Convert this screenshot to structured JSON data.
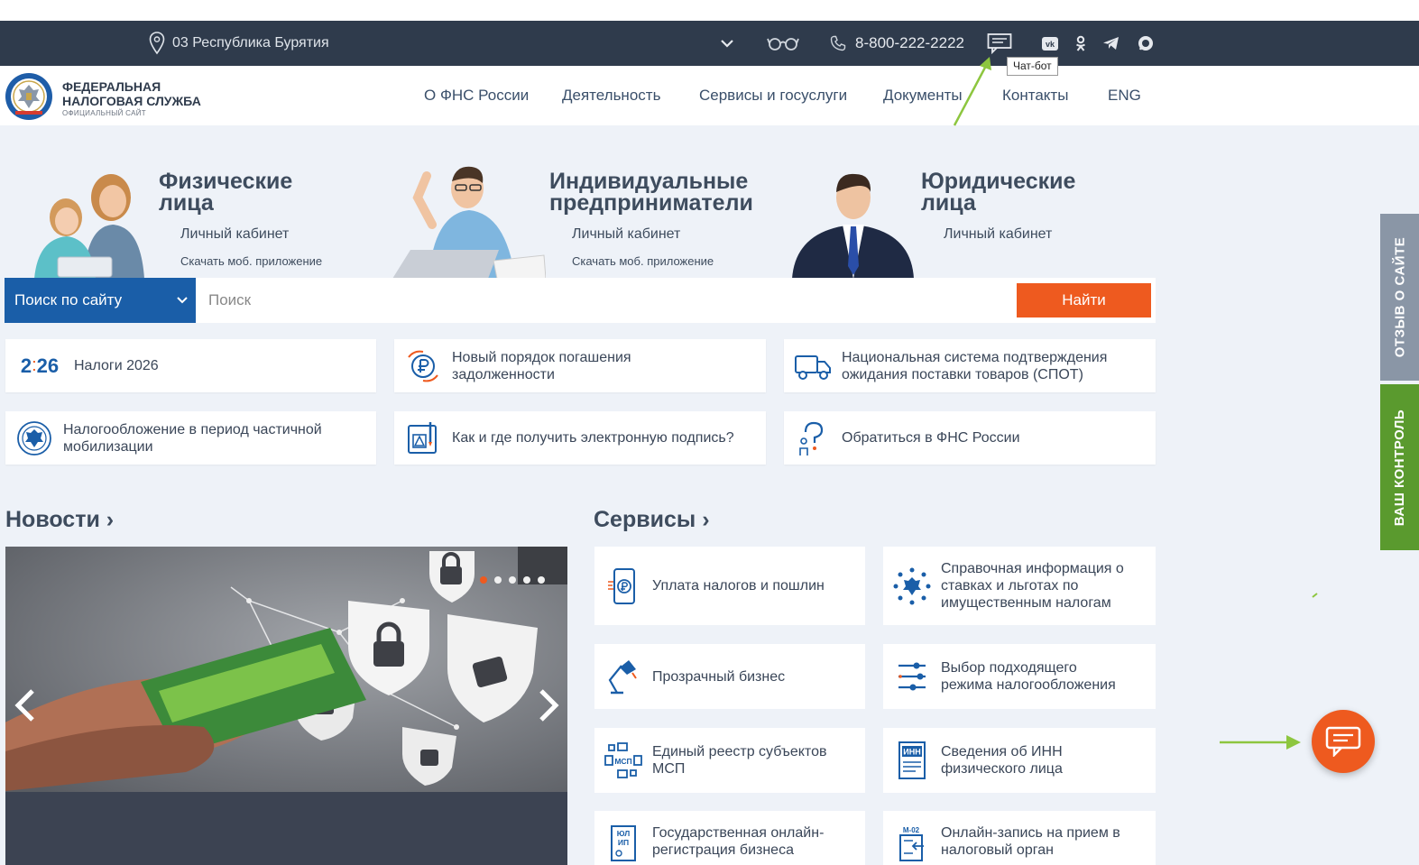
{
  "topbar": {
    "region": "03 Республика Бурятия",
    "phone": "8-800-222-2222",
    "chatbot_tooltip": "Чат-бот"
  },
  "logo": {
    "line1": "ФЕДЕРАЛЬНАЯ",
    "line2": "НАЛОГОВАЯ СЛУЖБА",
    "line3": "ОФИЦИАЛЬНЫЙ САЙТ"
  },
  "menu": [
    "О ФНС России",
    "Деятельность",
    "Сервисы и госуслуги",
    "Документы",
    "Контакты",
    "ENG"
  ],
  "hero": [
    {
      "title1": "Физические",
      "title2": "лица",
      "link": "Личный кабинет",
      "sub": "Скачать моб. приложение"
    },
    {
      "title1": "Индивидуальные",
      "title2": "предприниматели",
      "link": "Личный кабинет",
      "sub": "Скачать моб. приложение"
    },
    {
      "title1": "Юридические",
      "title2": "лица",
      "link": "Личный кабинет"
    }
  ],
  "search": {
    "scope": "Поиск по сайту",
    "placeholder": "Поиск",
    "button": "Найти"
  },
  "tiles": [
    {
      "icon": "year-2026",
      "icon_text_a": "2",
      "icon_text_b": "26",
      "text1": "Налоги 2026"
    },
    {
      "icon": "ruble-cycle-icon",
      "text1": "Новый порядок погашения",
      "text2": "задолженности"
    },
    {
      "icon": "truck-icon",
      "text1": "Национальная система подтверждения",
      "text2": "ожидания поставки товаров (СПОТ)"
    },
    {
      "icon": "emblem-icon",
      "text1": "Налогообложение в период частичной",
      "text2": "мобилизации"
    },
    {
      "icon": "e-signature-icon",
      "text1": "Как и где получить электронную подпись?"
    },
    {
      "icon": "question-person-icon",
      "text1": "Обратиться в ФНС России"
    }
  ],
  "sections": {
    "news": "Новости",
    "services": "Сервисы"
  },
  "services": [
    {
      "icon": "payment-phone-icon",
      "text1": "Уплата налогов и пошлин"
    },
    {
      "icon": "emblem-dots-icon",
      "text1": "Справочная информация о",
      "text2": "ставках и льготах по",
      "text3": "имущественным налогам"
    },
    {
      "icon": "lamp-icon",
      "text1": "Прозрачный бизнес"
    },
    {
      "icon": "sliders-icon",
      "text1": "Выбор подходящего",
      "text2": "режима налогообложения"
    },
    {
      "icon": "msp-registry-icon",
      "icon_label": "МСП",
      "text1": "Единый реестр субъектов",
      "text2": "МСП"
    },
    {
      "icon": "inn-doc-icon",
      "icon_label": "ИНН",
      "text1": "Сведения об ИНН",
      "text2": "физического лица"
    },
    {
      "icon": "ul-ip-doc-icon",
      "icon_label_a": "ЮЛ",
      "icon_label_b": "ИП",
      "text1": "Государственная онлайн-",
      "text2": "регистрация бизнеса"
    },
    {
      "icon": "m02-doc-icon",
      "icon_label": "М-02",
      "text1": "Онлайн-запись на прием в",
      "text2": "налоговый орган"
    }
  ],
  "sidetabs": {
    "feedback": "ОТЗЫВ О САЙТЕ",
    "control": "ВАШ КОНТРОЛЬ"
  },
  "colors": {
    "topbar": "#2f3b4c",
    "accent_orange": "#ee5a1f",
    "search_blue": "#1a5ea8",
    "arrow_green": "#8dc63f",
    "tab_gray": "#8a96a6",
    "tab_green": "#5a9a2e"
  }
}
